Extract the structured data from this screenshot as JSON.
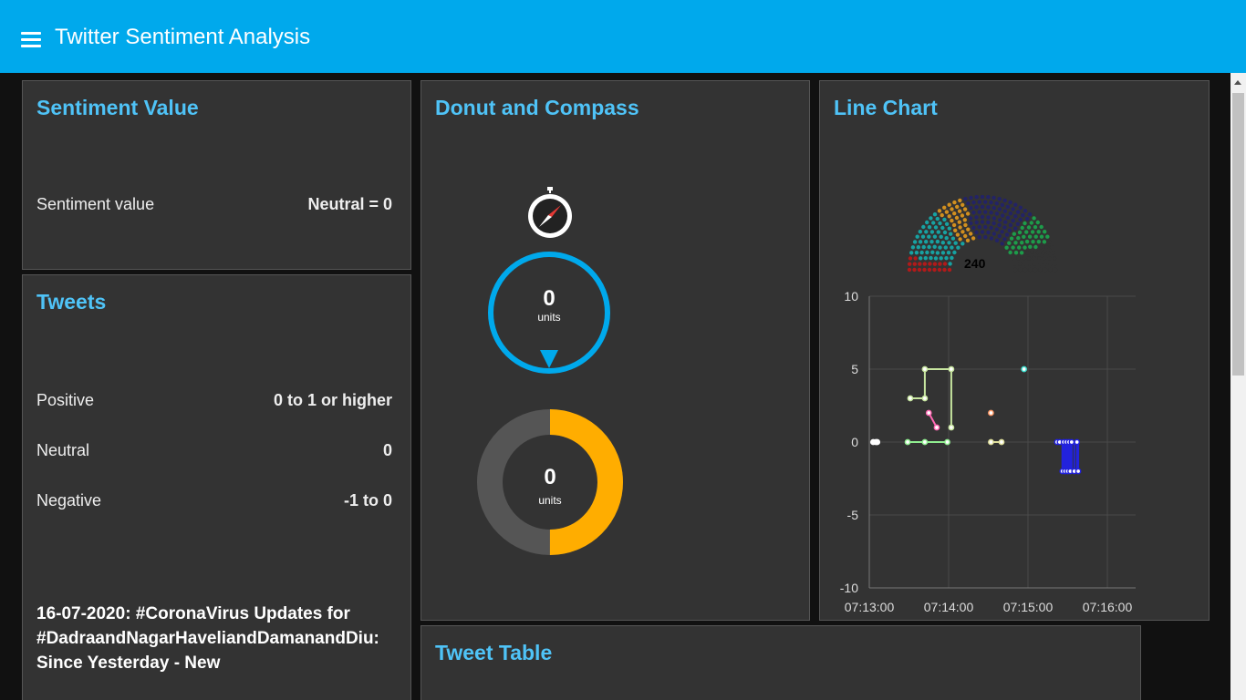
{
  "header": {
    "title": "Twitter Sentiment Analysis",
    "color": "#00a9ec"
  },
  "sentiment_card": {
    "title": "Sentiment Value",
    "label": "Sentiment value",
    "value": "Neutral = 0"
  },
  "tweets_card": {
    "title": "Tweets",
    "rows": [
      {
        "label": "Positive",
        "value": "0 to 1 or higher"
      },
      {
        "label": "Neutral",
        "value": "0"
      },
      {
        "label": "Negative",
        "value": "-1 to 0"
      }
    ],
    "latest_tweet": "16-07-2020: #CoronaVirus Updates for #DadraandNagarHaveliandDamanandDiu: Since Yesterday - New"
  },
  "donut_card": {
    "title": "Donut and Compass",
    "compass_icon": "compass-icon",
    "gauge": {
      "value": "0",
      "units": "units",
      "color": "#00a9ec"
    },
    "donut": {
      "value": "0",
      "units": "units",
      "fill_fraction": 0.5,
      "fill_color": "#ffad00",
      "track_color": "#555555"
    }
  },
  "line_card": {
    "title": "Line Chart",
    "parliament_total": "240",
    "parliament_colors": [
      "#b11a1a",
      "#17a2a2",
      "#d18f1f",
      "#232366",
      "#1d9c4a",
      "#333333"
    ]
  },
  "table_card": {
    "title": "Tweet Table"
  },
  "chart_data": {
    "type": "line",
    "x_ticks": [
      "07:13:00",
      "07:14:00",
      "07:15:00",
      "07:16:00"
    ],
    "y_ticks": [
      "10",
      "5",
      "0",
      "-5",
      "-10"
    ],
    "ylim": [
      -10,
      10
    ],
    "xlim_seconds": [
      0,
      200
    ],
    "grid": true,
    "series": [
      {
        "color": "#c8e6a0",
        "step": true,
        "points": [
          [
            31,
            3
          ],
          [
            42,
            3
          ],
          [
            42,
            5
          ],
          [
            62,
            5
          ],
          [
            62,
            1
          ]
        ]
      },
      {
        "color": "#ffffff",
        "step": false,
        "points": [
          [
            3,
            0
          ],
          [
            5,
            0
          ],
          [
            6,
            0
          ]
        ]
      },
      {
        "color": "#90ee90",
        "step": false,
        "points": [
          [
            29,
            0
          ],
          [
            42,
            0
          ],
          [
            59,
            0
          ]
        ]
      },
      {
        "color": "#ff69b4",
        "step": false,
        "points": [
          [
            45,
            2
          ],
          [
            51,
            1
          ]
        ]
      },
      {
        "color": "#ff9966",
        "step": false,
        "points": [
          [
            92,
            2
          ]
        ]
      },
      {
        "color": "#dddd99",
        "step": false,
        "points": [
          [
            92,
            0
          ],
          [
            100,
            0
          ]
        ]
      },
      {
        "color": "#40e0d0",
        "step": false,
        "points": [
          [
            117,
            5
          ]
        ]
      },
      {
        "color": "#2222dd",
        "step": true,
        "points": [
          [
            142,
            0
          ],
          [
            144,
            0
          ],
          [
            146,
            -2
          ],
          [
            147,
            0
          ],
          [
            148,
            -2
          ],
          [
            149,
            0
          ],
          [
            150,
            -2
          ],
          [
            151,
            0
          ],
          [
            152,
            -2
          ],
          [
            153,
            0
          ],
          [
            155,
            -2
          ],
          [
            157,
            0
          ],
          [
            158,
            -2
          ]
        ]
      }
    ]
  }
}
